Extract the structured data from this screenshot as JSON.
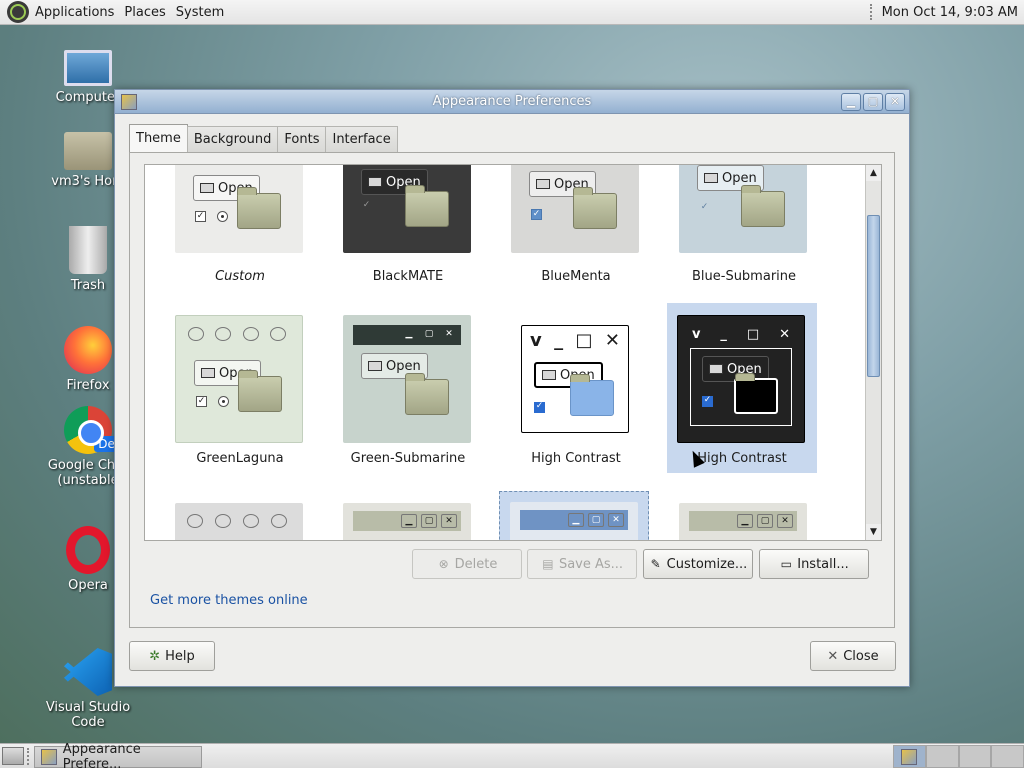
{
  "top_panel": {
    "menus": [
      "Applications",
      "Places",
      "System"
    ],
    "clock": "Mon Oct 14,  9:03 AM"
  },
  "desktop_icons": [
    {
      "label": "Computer",
      "icon": "computer-icon"
    },
    {
      "label": "vm3's Hom",
      "icon": "home-folder-icon"
    },
    {
      "label": "Trash",
      "icon": "trash-icon"
    },
    {
      "label": "Firefox",
      "icon": "firefox-icon"
    },
    {
      "label": "Google Chro",
      "label2": "(unstable",
      "badge": "Dev",
      "icon": "chrome-dev-icon"
    },
    {
      "label": "Opera",
      "icon": "opera-icon"
    },
    {
      "label": "Visual Studio Code",
      "icon": "vscode-icon"
    }
  ],
  "window": {
    "title": "Appearance Preferences",
    "tabs": [
      "Theme",
      "Background",
      "Fonts",
      "Interface"
    ],
    "active_tab": "Theme",
    "themes": [
      {
        "name": "Custom",
        "preview_button": "Open"
      },
      {
        "name": "BlackMATE",
        "preview_button": "Open"
      },
      {
        "name": "BlueMenta",
        "preview_button": "Open"
      },
      {
        "name": "Blue-Submarine",
        "preview_button": "Open"
      },
      {
        "name": "GreenLaguna",
        "preview_button": "Open"
      },
      {
        "name": "Green-Submarine",
        "preview_button": "Open"
      },
      {
        "name": "High Contrast",
        "preview_button": "Open"
      },
      {
        "name": "High Contrast",
        "preview_button": "Open",
        "selected": true
      }
    ],
    "buttons": {
      "delete": "Delete",
      "save_as": "Save As...",
      "customize": "Customize...",
      "install": "Install...",
      "help": "Help",
      "close": "Close"
    },
    "link": "Get more themes online"
  },
  "taskbar": {
    "task_label": "Appearance Prefere..."
  },
  "colors": {
    "selection": "#c8d8ee",
    "titlebar": "#93b0d1",
    "link": "#1a52a3"
  }
}
